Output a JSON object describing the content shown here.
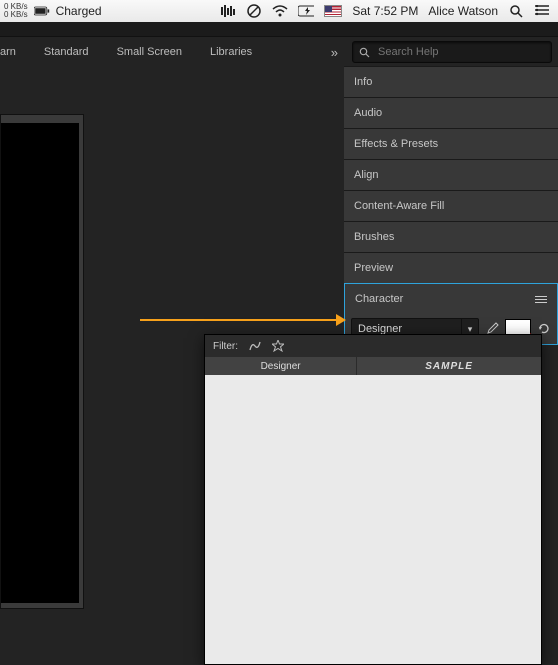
{
  "menubar": {
    "netspeed_up": "0 KB/s",
    "netspeed_down": "0 KB/s",
    "battery_label": "Charged",
    "datetime": "Sat 7:52 PM",
    "username": "Alice Watson"
  },
  "toolbar": {
    "tabs": [
      "arn",
      "Standard",
      "Small Screen",
      "Libraries"
    ],
    "search_placeholder": "Search Help"
  },
  "panels": {
    "items": [
      {
        "label": "Info"
      },
      {
        "label": "Audio"
      },
      {
        "label": "Effects & Presets"
      },
      {
        "label": "Align"
      },
      {
        "label": "Content-Aware Fill"
      },
      {
        "label": "Brushes"
      },
      {
        "label": "Preview"
      }
    ],
    "character_label": "Character",
    "font_value": "Designer"
  },
  "dropdown": {
    "filter_label": "Filter:",
    "col_name": "Designer",
    "col_sample": "SAMPLE"
  }
}
